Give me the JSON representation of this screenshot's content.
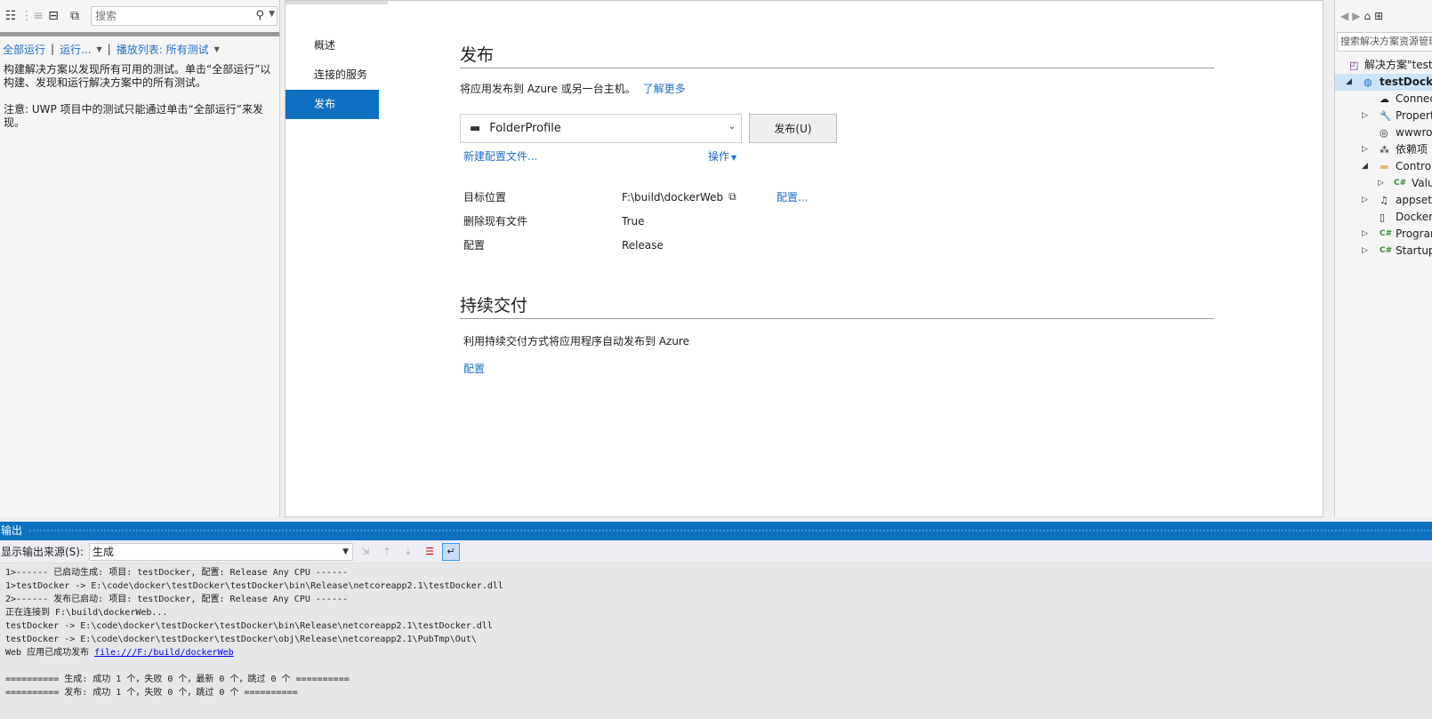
{
  "test_explorer": {
    "search_placeholder": "搜索",
    "run_all": "全部运行",
    "run": "运行...",
    "playlist": "播放列表: 所有测试",
    "message1": "构建解决方案以发现所有可用的测试。单击“全部运行”以构建、发现和运行解决方案中的所有测试。",
    "message2": "注意: UWP 项目中的测试只能通过单击“全部运行”来发现。"
  },
  "publish": {
    "nav": [
      "概述",
      "连接的服务",
      "发布"
    ],
    "title": "发布",
    "description": "将应用发布到 Azure 或另一台主机。",
    "learn_more": "了解更多",
    "profile": "FolderProfile",
    "publish_button": "发布(U)",
    "new_profile": "新建配置文件...",
    "actions": "操作",
    "properties": [
      {
        "key": "目标位置",
        "value": "F:\\build\\dockerWeb"
      },
      {
        "key": "删除现有文件",
        "value": "True"
      },
      {
        "key": "配置",
        "value": "Release"
      }
    ],
    "configure_link": "配置...",
    "cd_title": "持续交付",
    "cd_description": "利用持续交付方式将应用程序自动发布到 Azure",
    "cd_link": "配置"
  },
  "solution_explorer": {
    "search_placeholder": "搜索解决方案资源管理器",
    "nodes": [
      {
        "label": "解决方案\"testDocker\"",
        "icon": "solution-icon"
      },
      {
        "label": "testDocker",
        "icon": "web-project-icon"
      },
      {
        "label": "Connected Services",
        "icon": "cloud-icon"
      },
      {
        "label": "Properties",
        "icon": "wrench-icon"
      },
      {
        "label": "wwwroot",
        "icon": "globe-icon"
      },
      {
        "label": "依赖项",
        "icon": "dependencies-icon"
      },
      {
        "label": "Controllers",
        "icon": "folder-icon"
      },
      {
        "label": "ValuesController.cs",
        "icon": "csharp-icon"
      },
      {
        "label": "appsettings.json",
        "icon": "json-icon"
      },
      {
        "label": "Dockerfile",
        "icon": "file-icon"
      },
      {
        "label": "Program.cs",
        "icon": "csharp-icon"
      },
      {
        "label": "Startup.cs",
        "icon": "csharp-icon"
      }
    ]
  },
  "output": {
    "title": "输出",
    "source_label": "显示输出来源(S):",
    "source_value": "生成",
    "lines": [
      "1>------ 已启动生成: 项目: testDocker, 配置: Release Any CPU ------",
      "1>testDocker -> E:\\code\\docker\\testDocker\\testDocker\\bin\\Release\\netcoreapp2.1\\testDocker.dll",
      "2>------ 发布已启动: 项目: testDocker, 配置: Release Any CPU ------",
      "正在连接到 F:\\build\\dockerWeb...",
      "testDocker -> E:\\code\\docker\\testDocker\\testDocker\\bin\\Release\\netcoreapp2.1\\testDocker.dll",
      "testDocker -> E:\\code\\docker\\testDocker\\testDocker\\obj\\Release\\netcoreapp2.1\\PubTmp\\Out\\"
    ],
    "success_prefix": "Web 应用已成功发布 ",
    "success_link": "file:///F:/build/dockerWeb",
    "summary1": "========== 生成: 成功 1 个，失败 0 个，最新 0 个，跳过 0 个 ==========",
    "summary2": "========== 发布: 成功 1 个，失败 0 个，跳过 0 个 =========="
  }
}
